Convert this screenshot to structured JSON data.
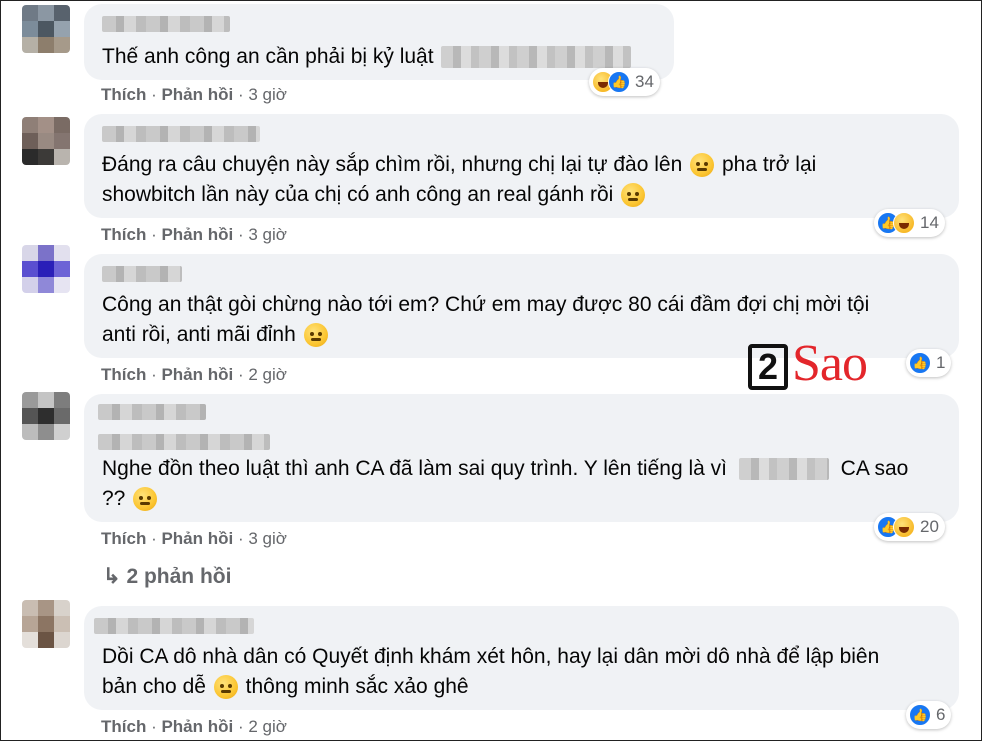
{
  "comments": [
    {
      "text_lines": [
        "Thế anh công an cần phải bị kỷ luật"
      ],
      "actions": {
        "like": "Thích",
        "reply": "Phản hồi",
        "time": "3 giờ"
      },
      "reaction_count": "34",
      "reactions": [
        "haha-icon",
        "like-icon"
      ]
    },
    {
      "text_lines": [
        "Đáng ra câu chuyện này sắp chìm rồi, nhưng chị lại tự đào lên",
        "pha trở lại",
        "showbitch lần này của chị có anh công an real gánh rồi"
      ],
      "actions": {
        "like": "Thích",
        "reply": "Phản hồi",
        "time": "3 giờ"
      },
      "reaction_count": "14",
      "reactions": [
        "like-icon",
        "haha-icon"
      ]
    },
    {
      "text_lines": [
        "Công an thật gòi chừng nào tới em? Chứ em may được 80 cái đầm đợi chị mời tội",
        "anti rồi, anti mãi đỉnh"
      ],
      "actions": {
        "like": "Thích",
        "reply": "Phản hồi",
        "time": "2 giờ"
      },
      "reaction_count": "1",
      "reactions": [
        "like-icon"
      ]
    },
    {
      "text_lines": [
        "Nghe đồn theo luật thì anh CA đã làm sai quy trình. Y lên tiếng là vì",
        "CA sao",
        "??"
      ],
      "actions": {
        "like": "Thích",
        "reply": "Phản hồi",
        "time": "3 giờ"
      },
      "reaction_count": "20",
      "reactions": [
        "like-icon",
        "haha-icon"
      ],
      "replies_label": "2 phản hồi"
    },
    {
      "text_lines": [
        "Dồi CA dô nhà dân có Quyết định khám xét hôn, hay lại dân mời dô nhà để lập biên",
        "bản cho dễ",
        "thông minh sắc xảo ghê"
      ],
      "actions": {
        "like": "Thích",
        "reply": "Phản hồi",
        "time": "2 giờ"
      },
      "reaction_count": "6",
      "reactions": [
        "like-icon"
      ]
    }
  ],
  "watermark": {
    "digit": "2",
    "word": "Sao"
  },
  "colors": {
    "bubble": "#f0f2f5",
    "meta": "#65676b",
    "like": "#1877f2",
    "brand_red": "#e3262b"
  }
}
